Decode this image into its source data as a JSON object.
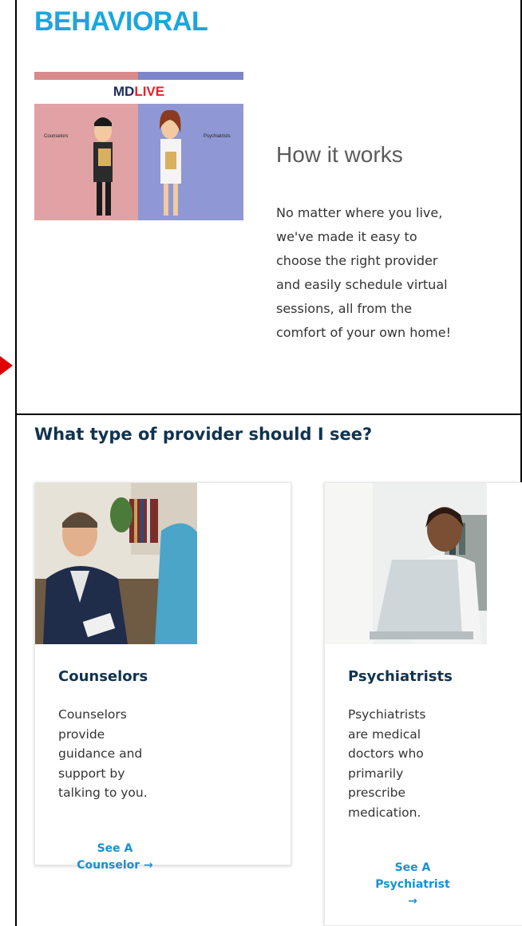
{
  "behavioral": {
    "title": "BEHAVIORAL",
    "video": {
      "logo_md": "MD",
      "logo_live": "LIVE",
      "label_left": "Counselors",
      "label_right": "Psychiatrists"
    },
    "how_it_works": {
      "title": "How it works",
      "body": "No matter where you live,\nwe've made it easy to\nchoose the right provider\nand easily schedule virtual\nsessions, all from the\ncomfort of your own home!"
    }
  },
  "providers": {
    "heading": "What type of provider should I see?",
    "cards": [
      {
        "title": "Counselors",
        "description": "Counselors\nprovide\nguidance and\nsupport by\ntalking to you.",
        "link": "See A\nCounselor →"
      },
      {
        "title": "Psychiatrists",
        "description": "Psychiatrists\nare medical\ndoctors who\nprimarily\nprescribe\nmedication.",
        "link": "See A\nPsychiatrist\n→"
      }
    ]
  },
  "colors": {
    "accent_blue": "#1aa6e0",
    "heading_navy": "#10334f",
    "link_blue": "#1a8fd0",
    "pointer_red": "#e00000"
  }
}
